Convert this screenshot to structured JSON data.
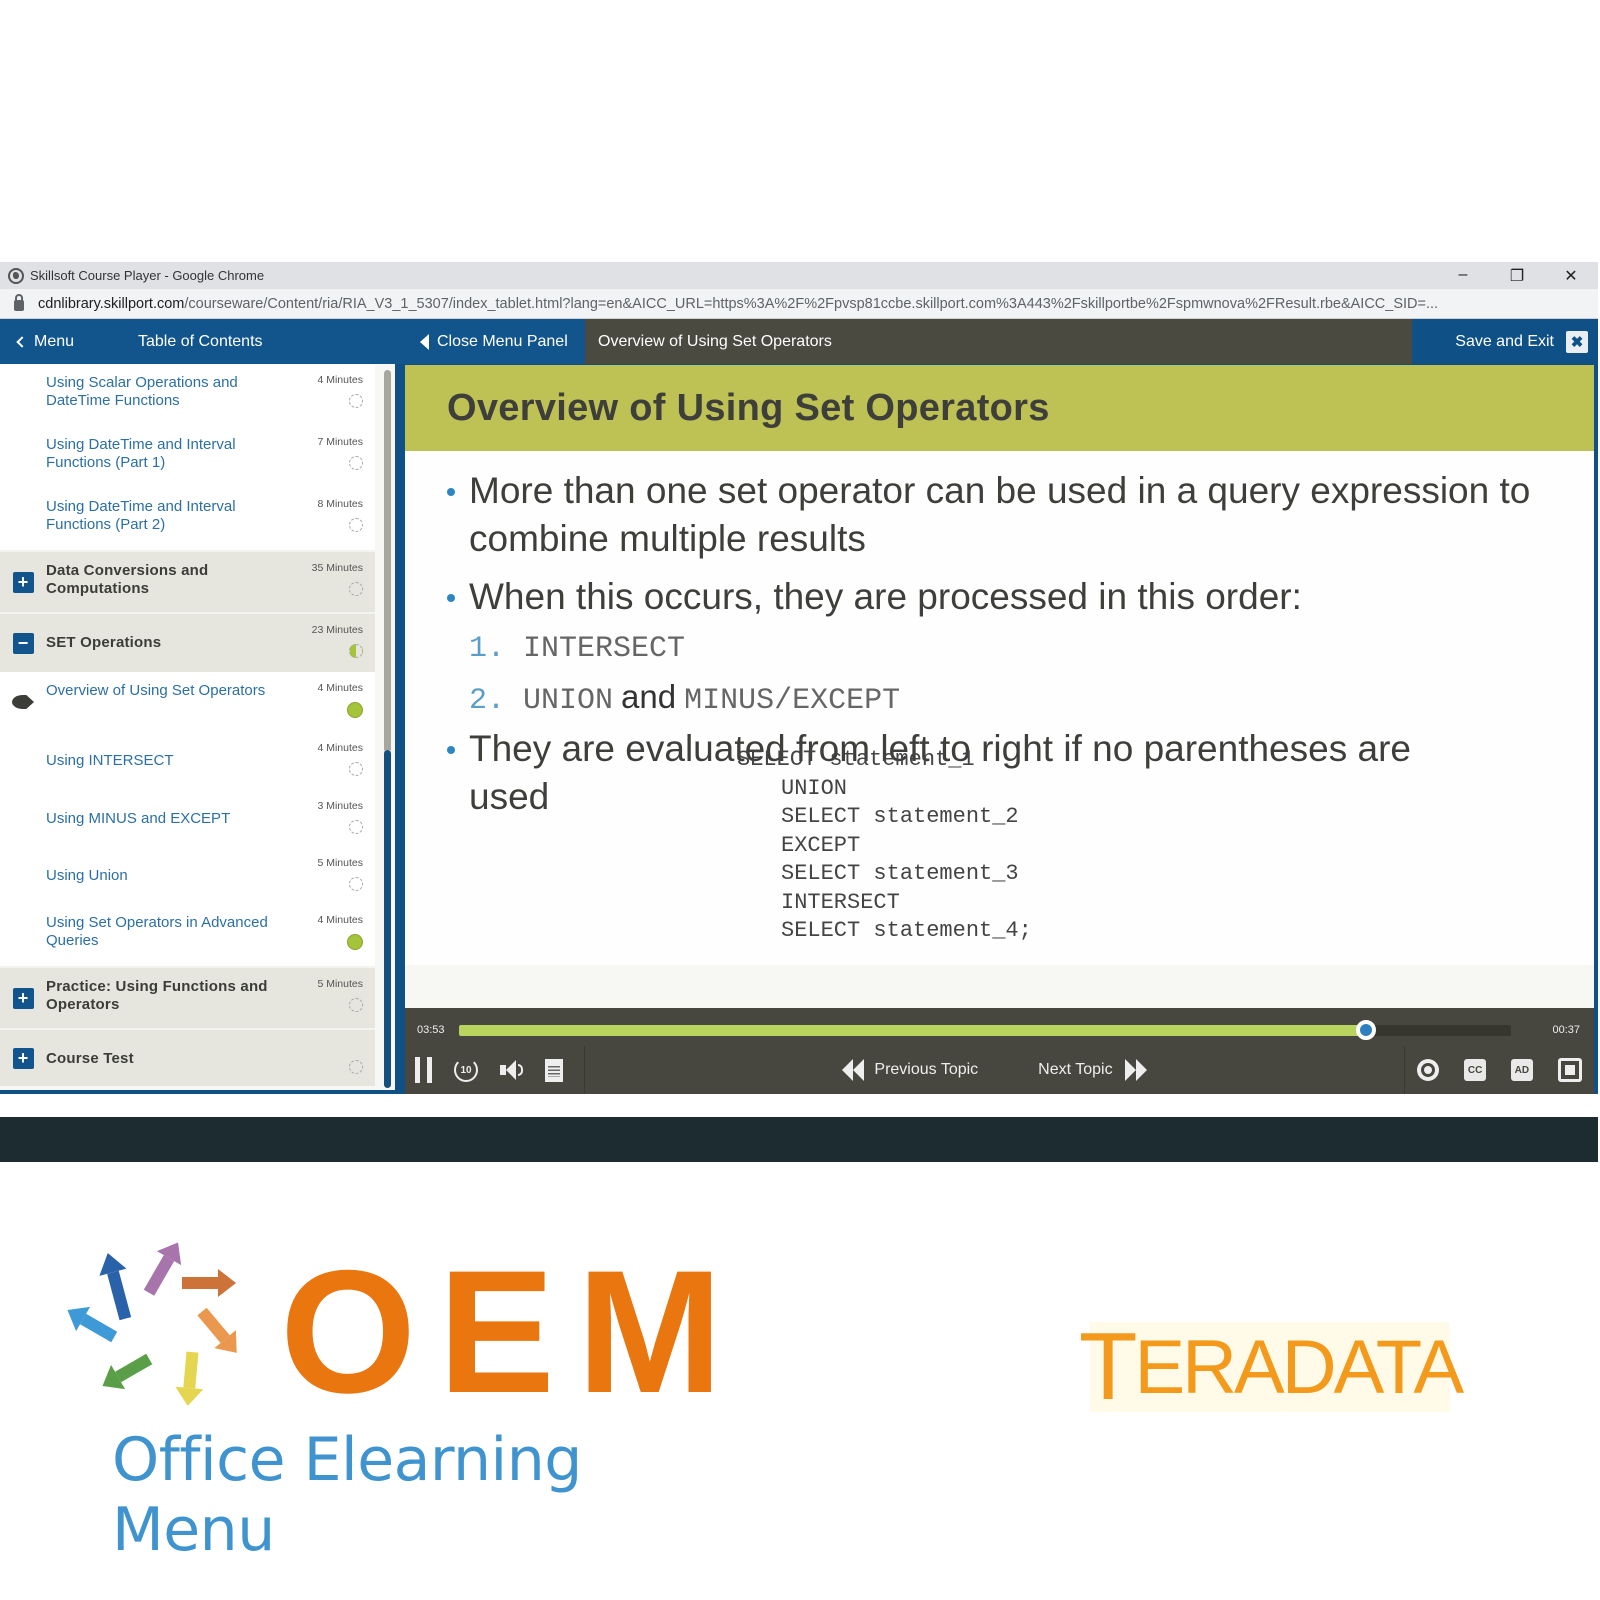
{
  "browser": {
    "title": "Skillsoft Course Player - Google Chrome",
    "url_host": "cdnlibrary.skillport.com",
    "url_path": "/courseware/Content/ria/RIA_V3_1_5307/index_tablet.html?lang=en&AICC_URL=https%3A%2F%2Fpvsp81ccbe.skillport.com%3A443%2Fskillportbe%2Fspmwnova%2FResult.rbe&AICC_SID=...",
    "controls": {
      "minimize": "–",
      "restore": "❐",
      "close": "✕"
    }
  },
  "topnav": {
    "menu_label": "Menu",
    "toc_label": "Table of Contents",
    "close_panel_label": "Close Menu Panel",
    "current_topic": "Overview of Using Set Operators",
    "save_exit_label": "Save and Exit",
    "save_exit_icon": "✖"
  },
  "toc": {
    "items": [
      {
        "label": "Using Scalar Operations and DateTime Functions",
        "duration": "4 Minutes",
        "type": "topic",
        "status": "not-started"
      },
      {
        "label": "Using DateTime and Interval Functions (Part 1)",
        "duration": "7 Minutes",
        "type": "topic",
        "status": "not-started"
      },
      {
        "label": "Using DateTime and Interval Functions (Part 2)",
        "duration": "8 Minutes",
        "type": "topic",
        "status": "not-started"
      },
      {
        "label": "Data Conversions and Computations",
        "duration": "35 Minutes",
        "type": "section",
        "expand": "+",
        "status": "not-started"
      },
      {
        "label": "SET Operations",
        "duration": "23 Minutes",
        "type": "section",
        "expand": "−",
        "status": "in-progress"
      },
      {
        "label": "Overview of Using Set Operators",
        "duration": "4 Minutes",
        "type": "topic",
        "status": "complete",
        "current": true
      },
      {
        "label": "Using INTERSECT",
        "duration": "4 Minutes",
        "type": "topic",
        "status": "not-started"
      },
      {
        "label": "Using MINUS and EXCEPT",
        "duration": "3 Minutes",
        "type": "topic",
        "status": "not-started"
      },
      {
        "label": "Using Union",
        "duration": "5 Minutes",
        "type": "topic",
        "status": "not-started"
      },
      {
        "label": "Using Set Operators in Advanced Queries",
        "duration": "4 Minutes",
        "type": "topic",
        "status": "complete"
      },
      {
        "label": "Practice: Using Functions and Operators",
        "duration": "5 Minutes",
        "type": "section",
        "expand": "+",
        "status": "not-started"
      },
      {
        "label": "Course Test",
        "duration": "",
        "type": "section",
        "expand": "+",
        "status": "not-started"
      }
    ]
  },
  "slide": {
    "title": "Overview of Using Set Operators",
    "bullet1": "More than one set operator can be used in a query expression to combine multiple results",
    "bullet2": "When this occurs, they are processed in this order:",
    "order": [
      {
        "num": "1.",
        "parts": [
          "INTERSECT"
        ]
      },
      {
        "num": "2.",
        "code1": "UNION",
        "joiner": "and",
        "code2": "MINUS/EXCEPT"
      }
    ],
    "bullet3": "They are evaluated from left to right if no parentheses are used",
    "code_lines": [
      "SELECT statement_1",
      "UNION",
      "SELECT statement_2",
      "EXCEPT",
      "SELECT statement_3",
      "INTERSECT",
      "SELECT statement_4;"
    ]
  },
  "player": {
    "elapsed": "03:53",
    "remaining": "00:37",
    "progress_fraction": 0.862,
    "replay_label": "10",
    "prev_label": "Previous Topic",
    "next_label": "Next Topic",
    "cc_label": "CC",
    "ad_label": "AD"
  },
  "logos": {
    "oem_word": "OEM",
    "oem_tagline": "Office Elearning Menu",
    "teradata_first": "T",
    "teradata_rest": "ERADATA"
  },
  "colors": {
    "brand_blue": "#11558c",
    "slide_header": "#bec254",
    "progress_fill": "#b9d35f",
    "complete_status": "#a6c43a",
    "oem_orange": "#e9760f",
    "oem_blue": "#3f93cf",
    "teradata_orange": "#f39a1c"
  }
}
